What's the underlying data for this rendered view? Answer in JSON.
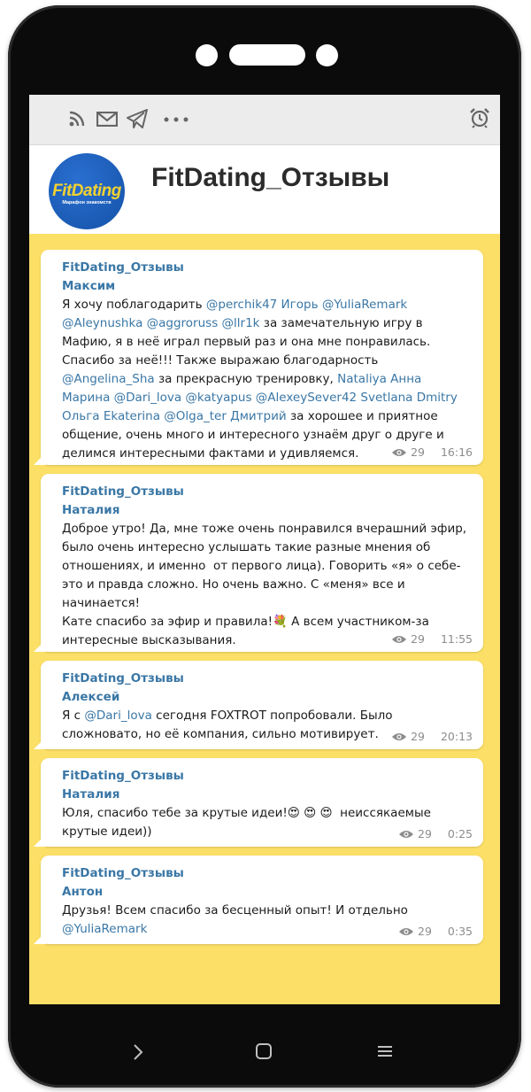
{
  "status_icons": [
    "rss-icon",
    "mail-icon",
    "telegram-icon",
    "more-dots-icon",
    "alarm-icon"
  ],
  "channel": {
    "title": "FitDating_Отзывы",
    "logo_text": "FitDating",
    "logo_subtitle": "Марафон знакомств"
  },
  "messages": [
    {
      "channel": "FitDating_Отзывы",
      "author": "Максим",
      "segments": [
        {
          "t": "Я хочу поблагодарить "
        },
        {
          "t": "@perchik47 Игорь @YuliaRemark @Aleynushka @aggroruss @llr1k",
          "m": true
        },
        {
          "t": " за замечательную игру в Мафию, я в неё играл первый раз и она мне понравилась. Спасибо за неё!!! Также выражаю благодарность "
        },
        {
          "t": "@Angelina_Sha",
          "m": true
        },
        {
          "t": " за прекрасную тренировку, "
        },
        {
          "t": "Nataliya Анна Марина @Dari_lova @katyapus @AlexeySever42 Svetlana Dmitry Ольга Ekaterina @Olga_ter Дмитрий",
          "m": true
        },
        {
          "t": " за хорошее и приятное общение, очень много и интересного узнаём друг о друге и делимся интересными фактами и удивляемся."
        }
      ],
      "views": "29",
      "time": "16:16"
    },
    {
      "channel": "FitDating_Отзывы",
      "author": "Наталия",
      "segments": [
        {
          "t": "Доброе утро! Да, мне тоже очень понравился вчерашний эфир, было очень интересно услышать такие разные мнения об отношениях, и именно  от первого лица). Говорить «я» о себе- это и правда сложно. Но очень важно. С «меня» все и начинается!\nКате спасибо за эфир и правила!💐 А всем участником-за интересные высказывания."
        }
      ],
      "views": "29",
      "time": "11:55"
    },
    {
      "channel": "FitDating_Отзывы",
      "author": "Алексей",
      "segments": [
        {
          "t": "Я с "
        },
        {
          "t": "@Dari_lova",
          "m": true
        },
        {
          "t": " сегодня FOXTROT попробовали. Было сложновато, но её компания, сильно мотивирует."
        }
      ],
      "views": "29",
      "time": "20:13"
    },
    {
      "channel": "FitDating_Отзывы",
      "author": "Наталия",
      "segments": [
        {
          "t": "Юля, спасибо тебе за крутые идеи!😍 😍 😍  неиссякаемые крутые идеи))"
        }
      ],
      "views": "29",
      "time": "0:25"
    },
    {
      "channel": "FitDating_Отзывы",
      "author": "Антон",
      "segments": [
        {
          "t": "Друзья! Всем спасибо за бесценный опыт! И отдельно "
        },
        {
          "t": "@YuliaRemark",
          "m": true
        }
      ],
      "views": "29",
      "time": "0:35"
    }
  ],
  "nav": [
    "back-chevron-icon",
    "home-square-icon",
    "menu-lines-icon"
  ],
  "colors": {
    "background": "#fcdf66",
    "link": "#3a77a6",
    "phone_frame": "#0b0b0b"
  }
}
